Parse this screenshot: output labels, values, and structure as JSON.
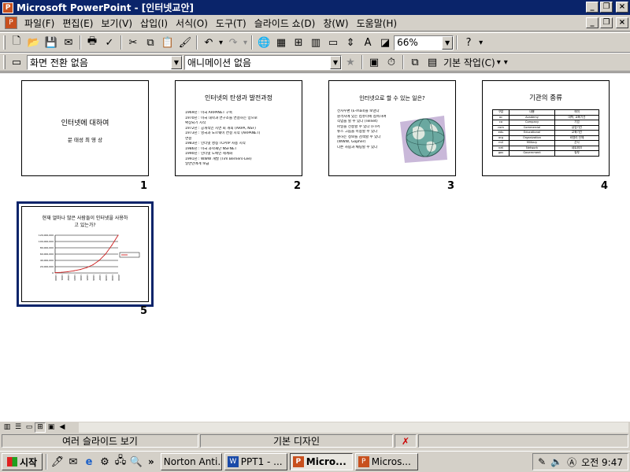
{
  "window": {
    "title": "Microsoft PowerPoint - [인터넷교안]"
  },
  "menu": [
    "파일(F)",
    "편집(E)",
    "보기(V)",
    "삽입(I)",
    "서식(O)",
    "도구(T)",
    "슬라이드 쇼(D)",
    "창(W)",
    "도움말(H)"
  ],
  "toolbar": {
    "zoom": "66%"
  },
  "toolbar2": {
    "transition": "화면 전환 없음",
    "animation": "애니메이션 없음",
    "task_label": "기본 작업(C)"
  },
  "slides": [
    {
      "number": "1",
      "title": "인터넷에 대하여",
      "subtitle": "문 태성  최 영 상"
    },
    {
      "number": "2",
      "title": "인터넷의 탄생과 발전과정",
      "bullets": [
        "1969년 : 미국 ARPANET 구축",
        "1970년 : 미국 대학과 연구소를 연결하는 망으로",
        "            확장되기 시작",
        "1972년 : 공개적인 시연 회 개최 (ARPA, NSF)",
        "1973년 : 영국과 노르웨이 연결 시작 (ARPANET)",
        "            연결",
        "1983년 : 인터넷 명칭 TCP/IP 사용 시작",
        "1986년 : 미국 과학재단 NSFNET",
        "1990년 : 인터넷 도메인 세계화",
        "1991년 : WWW 개발 (Tim Berners-Lee)",
        "            일반인에게 보급"
      ]
    },
    {
      "number": "3",
      "title": "인터넷으로 할 수 있는 일은?",
      "bullets": [
        "전자우편 (E-mail)을 보낸다",
        "원격지에 있는 컴퓨터에 접속하여",
        "  작업을 할 수 있다 (Telnet)",
        "파일을 전송할 수 있다 (FTP)",
        "뉴스 그룹을 이용할 수 있다",
        "원하는 정보를 검색할 수 있다",
        "  (WWW, Gopher)",
        "다른 사람과 채팅할 수 있다"
      ]
    },
    {
      "number": "4",
      "title": "기관의 종류",
      "table": [
        [
          "구분",
          "내용",
          "의미"
        ],
        [
          "ac",
          "Academy",
          "대학, 교육기관"
        ],
        [
          "co",
          "Company",
          "기업"
        ],
        [
          "com",
          "Commercial",
          "상업기관"
        ],
        [
          "edu",
          "Educational",
          "교육기관"
        ],
        [
          "org",
          "Organization",
          "비영리 단체"
        ],
        [
          "mil",
          "Military",
          "군사"
        ],
        [
          "net",
          "Network",
          "네트워크"
        ],
        [
          "gov",
          "Government",
          "정부"
        ]
      ]
    },
    {
      "number": "5",
      "title": "현재 얼마나 많은 사람들이 인터넷을 사용하고 있는가?",
      "chart_data": {
        "type": "line",
        "x": [
          "1990",
          "1991",
          "1992",
          "1993",
          "1994",
          "1995",
          "1996",
          "1997",
          "1998",
          "1999",
          "2000"
        ],
        "series": [
          {
            "name": "",
            "values": [
              1,
              2,
              4,
              7,
              11,
              17,
              26,
              40,
              60,
              88,
              120
            ]
          }
        ],
        "yticks": [
          "120,000,000",
          "100,000,000",
          "80,000,000",
          "60,000,000",
          "40,000,000",
          "20,000,000",
          "0"
        ],
        "ylim": [
          0,
          120
        ],
        "line_color": "#cc2020",
        "grid": true
      }
    }
  ],
  "status": {
    "view": "여러 슬라이드 보기",
    "design": "기본 디자인"
  },
  "taskbar": {
    "start": "시작",
    "chevron": "»",
    "tasks": [
      {
        "label": "Norton Anti...",
        "active": false
      },
      {
        "label": "PPT1 - ...",
        "active": false
      },
      {
        "label": "Micro...",
        "active": true
      },
      {
        "label": "Micros...",
        "active": false
      }
    ],
    "clock": "오전 9:47"
  }
}
